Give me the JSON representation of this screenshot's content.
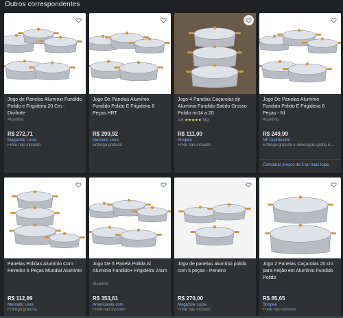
{
  "section_title": "Outros correspondentes",
  "products": [
    {
      "title": "Jogo de Panelas Alumínio Fundido Polido e Frigideira 20 Cm - Diviforte",
      "subtitle": "Alumínio",
      "rating": "",
      "review_count": "",
      "price": "R$ 272,71",
      "merchant": "Magazine Luiza",
      "shipping": "Frete não incluído",
      "compare": ""
    },
    {
      "title": "Jogo De Panelas Alumínio Fundido Polido E Frigideira 6 Peças HRT",
      "subtitle": "",
      "rating": "",
      "review_count": "",
      "price": "R$ 299,92",
      "merchant": "Mercado Livre",
      "shipping": "Entrega gratuita",
      "compare": ""
    },
    {
      "title": "Jogo 4 Panelas Caçarolas de Alumínio Fundido Batido Grosso Polido no14 a 20",
      "subtitle": "",
      "rating": "4,6",
      "stars": "★★★★★",
      "review_count": "362",
      "price": "R$ 111,00",
      "merchant": "Shopee",
      "shipping": "Frete não incluído",
      "compare": ""
    },
    {
      "title": "Jogo De Panelas Alumínio Fundido Polido E Frigideira 6 Peças - Nf",
      "subtitle": "Alumínio",
      "rating": "",
      "review_count": "",
      "price": "R$ 249,99",
      "merchant": "NF Distribuidor",
      "shipping": "Entrega gratuita e devolução grátis e...",
      "compare": "Comparar preços de 5 ou mais lojas"
    },
    {
      "title": "Panelas Polidas Alumínio Com Fevedor 6 Peças Mundial Alumínio",
      "subtitle": "",
      "rating": "",
      "review_count": "",
      "price": "R$ 112,99",
      "merchant": "Mercado Livre",
      "shipping": "Entrega gratuita",
      "compare": ""
    },
    {
      "title": "Jogo De 5 Panela Polida Al Alumínio Fundido+ Frigideira 24cm",
      "subtitle": "Alumínio",
      "rating": "",
      "review_count": "",
      "price": "R$ 353,61",
      "merchant": "Americanas.com",
      "shipping": "Frete não incluído",
      "compare": ""
    },
    {
      "title": "Jogo de panelas alumínio polido com 5 peças - Peneiro",
      "subtitle": "",
      "rating": "",
      "review_count": "",
      "price": "R$ 270,00",
      "merchant": "Magazine Luiza",
      "shipping": "Frete não incluído",
      "compare": ""
    },
    {
      "title": "Jogo 2 Panelas Caçarolas 20 cm para Feijão em Alumínio Fundido Polido",
      "subtitle": "",
      "rating": "",
      "review_count": "",
      "price": "R$ 85,65",
      "merchant": "Shopee",
      "shipping": "Frete não incluído",
      "compare": ""
    }
  ],
  "colors": {
    "background": "#202124",
    "card": "#303134",
    "link": "#8ab4f8",
    "muted": "#9aa0a6",
    "star": "#fdd663"
  },
  "icons": {
    "favorite": "heart-outline-icon"
  }
}
